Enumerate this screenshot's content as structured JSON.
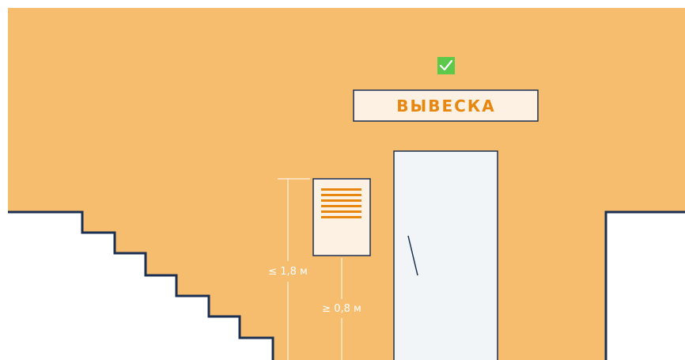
{
  "sign": {
    "label": "ВЫВЕСКА",
    "status": "check-icon"
  },
  "dimensions": {
    "max_height_label": "≤ 1,8 м",
    "min_height_label": "≥ 0,8 м"
  },
  "colors": {
    "wall": "#f7bd6e",
    "outline": "#1b2f52",
    "sign_bg": "#fdf1e4",
    "accent": "#e8870f",
    "check": "#5cc94a",
    "door": "#f2f5f7"
  }
}
